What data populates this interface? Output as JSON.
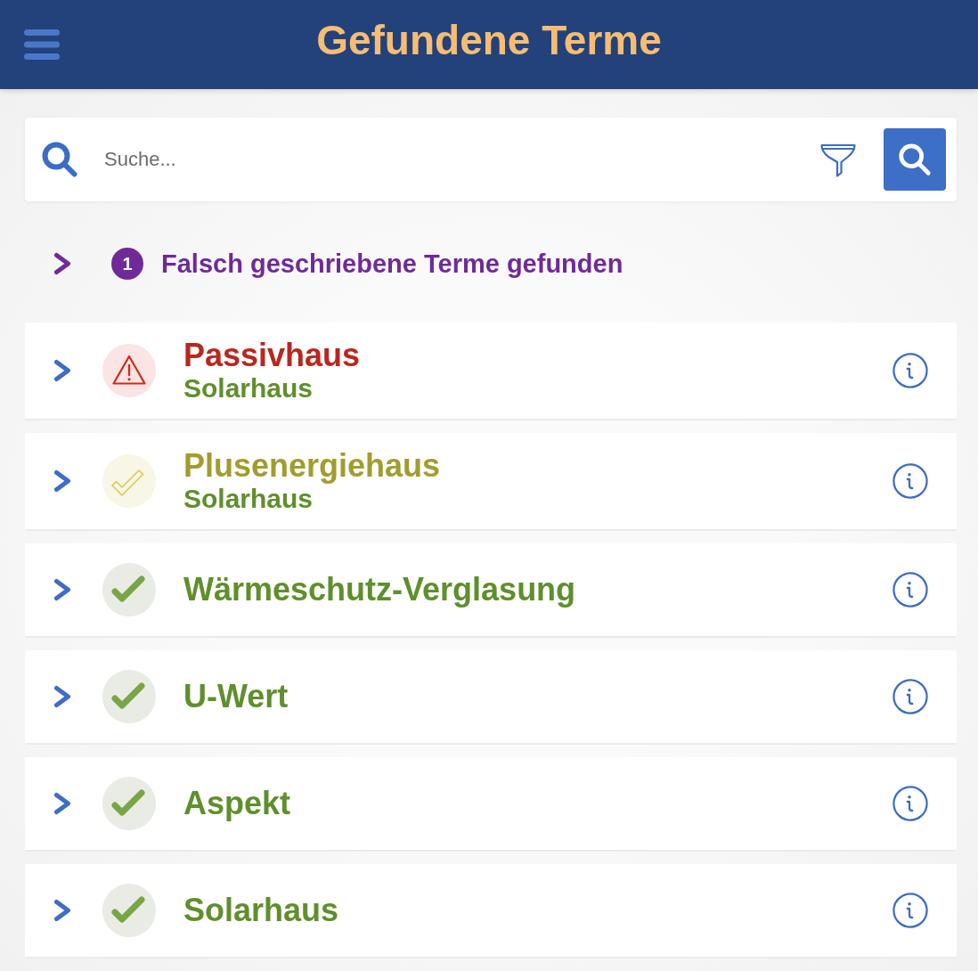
{
  "header": {
    "title": "Gefundene Terme"
  },
  "search": {
    "placeholder": "Suche..."
  },
  "misspelled": {
    "count": "1",
    "label": "Falsch geschriebene Terme gefunden",
    "expanded": false
  },
  "terms": [
    {
      "kind": "warning",
      "title": "Passivhaus",
      "subtitle": "Solarhaus",
      "expanded": false
    },
    {
      "kind": "partial",
      "title": "Plusenergiehaus",
      "subtitle": "Solarhaus",
      "expanded": false
    },
    {
      "kind": "ok",
      "title": "Wärmeschutz-Verglasung",
      "expanded": false
    },
    {
      "kind": "ok",
      "title": "U-Wert",
      "expanded": false
    },
    {
      "kind": "ok",
      "title": "Aspekt",
      "expanded": false
    },
    {
      "kind": "ok",
      "title": "Solarhaus",
      "expanded": false
    }
  ]
}
